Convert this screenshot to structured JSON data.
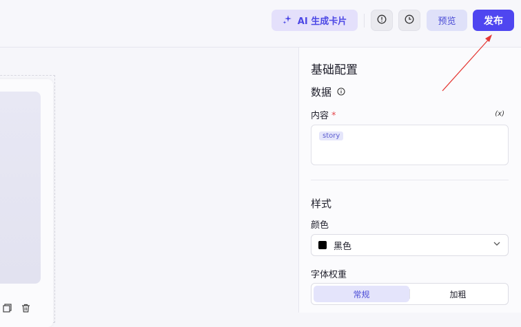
{
  "header": {
    "ai_button_label": "AI 生成卡片",
    "preview_label": "预览",
    "publish_label": "发布"
  },
  "panel": {
    "title": "基础配置",
    "data_section": {
      "heading": "数据",
      "content_label": "内容",
      "required_mark": "*",
      "fx_label": "(x)",
      "content_tag": "story"
    },
    "style_section": {
      "heading": "样式",
      "color_label": "颜色",
      "color_value": "黑色",
      "color_swatch": "#000000",
      "weight_label": "字体权重",
      "weight_options": [
        "常规",
        "加粗"
      ],
      "weight_selected": "常规"
    }
  },
  "colors": {
    "accent": "#4f46f0",
    "annotation_arrow": "#e53935"
  }
}
